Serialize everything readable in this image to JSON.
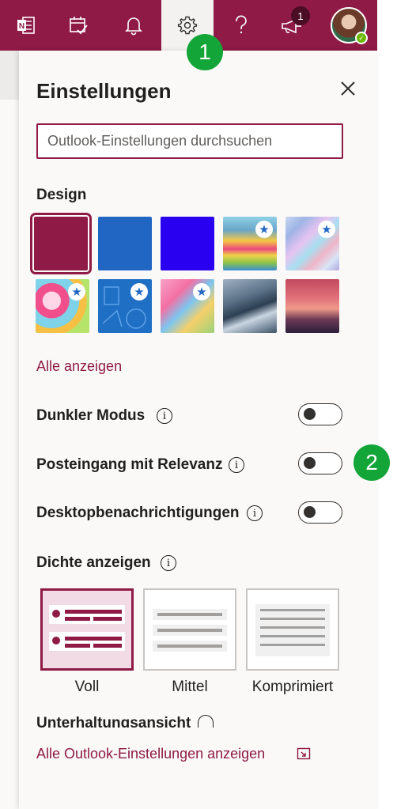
{
  "topbar": {
    "buttons": [
      "onenote-icon",
      "calendar-check-icon",
      "bell-icon",
      "gear-icon",
      "help-icon",
      "megaphone-icon"
    ],
    "notification_count": "1",
    "bg_color": "#8e1a45"
  },
  "panel": {
    "title": "Einstellungen",
    "search_placeholder": "Outlook-Einstellungen durchsuchen",
    "design_label": "Design",
    "themes": [
      {
        "name": "burgundy",
        "color": "#8e1a45",
        "selected": true,
        "premium": false
      },
      {
        "name": "blue",
        "color": "#2266c4",
        "selected": false,
        "premium": false
      },
      {
        "name": "indigo",
        "color": "#2a00f0",
        "selected": false,
        "premium": false
      },
      {
        "name": "rainbow",
        "selected": false,
        "premium": true
      },
      {
        "name": "ribbons",
        "selected": false,
        "premium": true
      },
      {
        "name": "comic",
        "selected": false,
        "premium": true
      },
      {
        "name": "blueprint",
        "selected": false,
        "premium": true
      },
      {
        "name": "pixel-city",
        "selected": false,
        "premium": true
      },
      {
        "name": "mountain",
        "selected": false,
        "premium": false
      },
      {
        "name": "palms",
        "selected": false,
        "premium": false
      }
    ],
    "show_all_link": "Alle anzeigen",
    "dark_mode_label": "Dunkler Modus",
    "focused_inbox_label": "Posteingang mit Relevanz",
    "desktop_notifications_label": "Desktopbenachrichtigungen",
    "density_label": "Dichte anzeigen",
    "density_options": [
      "Voll",
      "Mittel",
      "Komprimiert"
    ],
    "conversation_view_label": "Unterhaltungsansicht",
    "all_settings_link": "Alle Outlook-Einstellungen anzeigen"
  },
  "callouts": [
    "1",
    "2"
  ]
}
